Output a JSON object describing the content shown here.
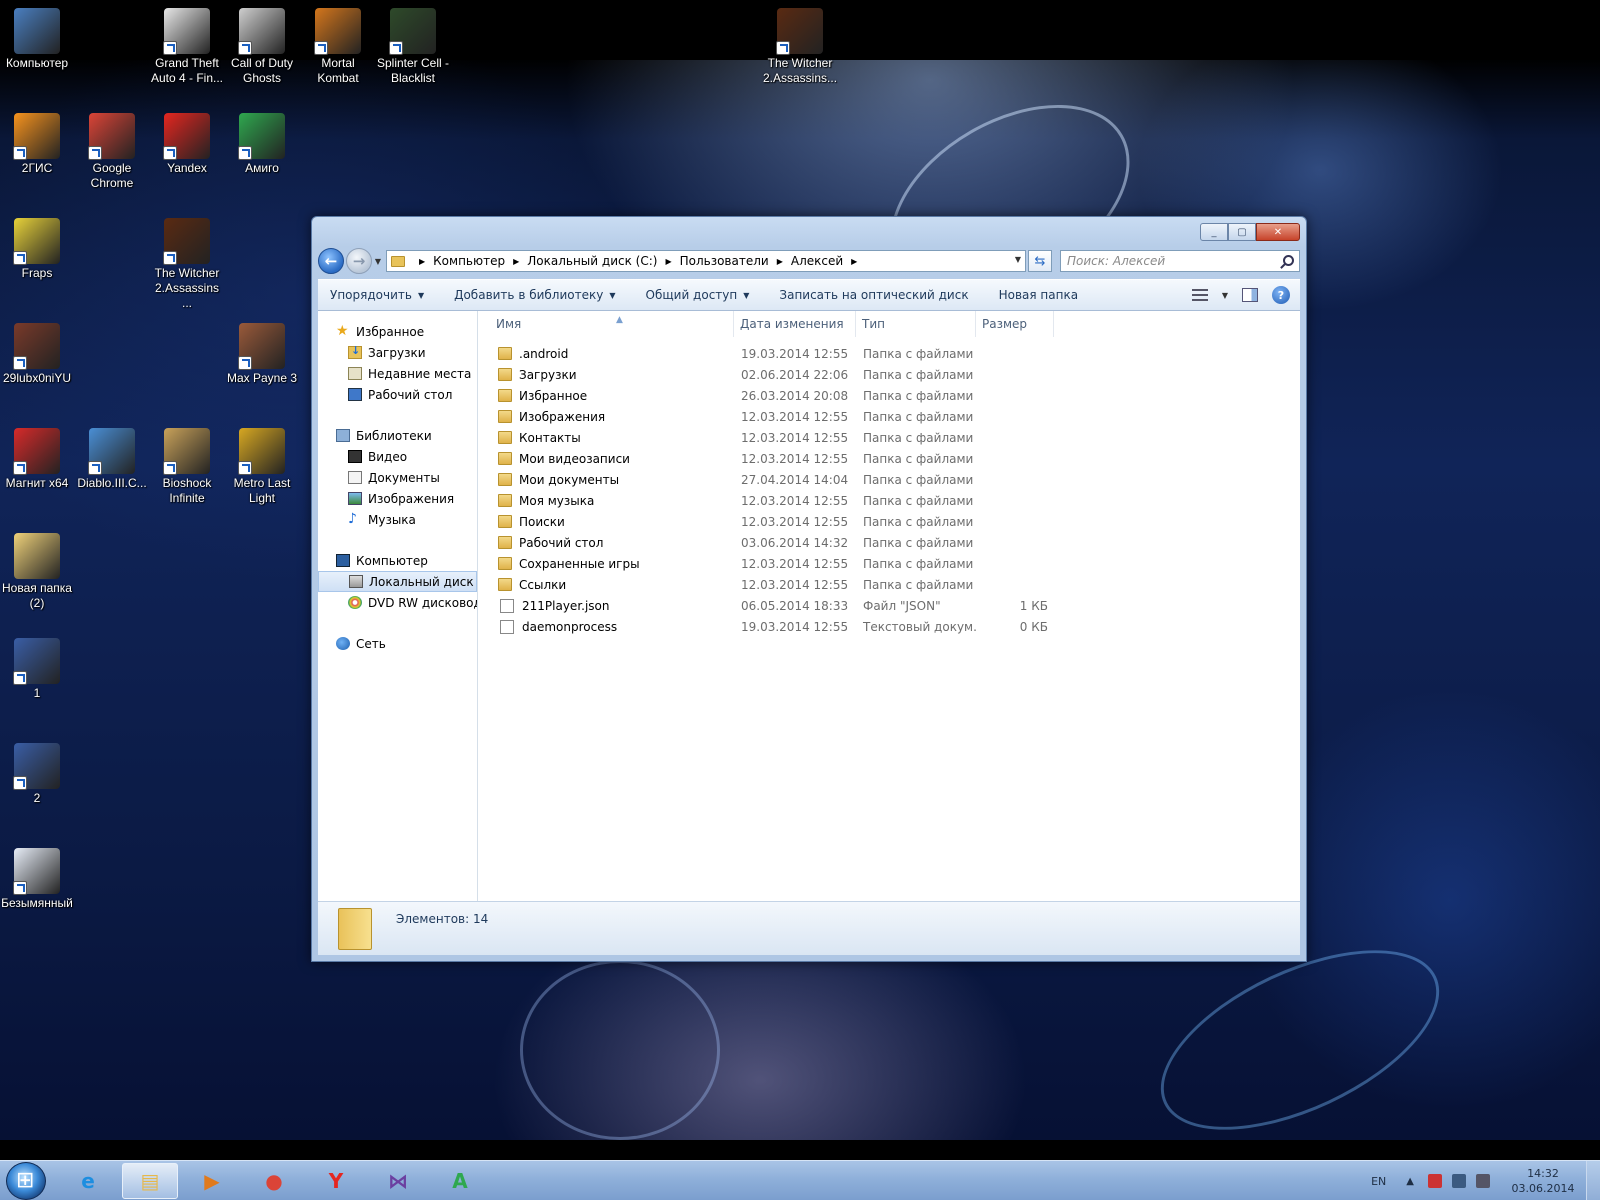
{
  "desktop": {
    "icons": [
      {
        "label": "Компьютер",
        "color": "#4a7fc1"
      },
      {
        "label": "Grand Theft Auto 4 - Fin...",
        "color": "#e8e8e8"
      },
      {
        "label": "Call of Duty Ghosts",
        "color": "#cfcfcf"
      },
      {
        "label": "Mortal Kombat",
        "color": "#d4761c"
      },
      {
        "label": "Splinter Cell - Blacklist",
        "color": "#2e4a2a"
      },
      {
        "label": "The Witcher 2.Assassins...",
        "color": "#5a2a12"
      },
      {
        "label": "2ГИС",
        "color": "#f7931e"
      },
      {
        "label": "Google Chrome",
        "color": "#db4437"
      },
      {
        "label": "Yandex",
        "color": "#e52620"
      },
      {
        "label": "Амиго",
        "color": "#2fa84f"
      },
      {
        "label": "Fraps",
        "color": "#e8d23a"
      },
      {
        "label": "The Witcher 2.Assassins ...",
        "color": "#5a2a12"
      },
      {
        "label": "29lubx0niYU",
        "color": "#7a3a2a"
      },
      {
        "label": "Max Payne 3",
        "color": "#9a5a3a"
      },
      {
        "label": "Магнит x64",
        "color": "#d82a2a"
      },
      {
        "label": "Diablo.III.C...",
        "color": "#4a8fd6"
      },
      {
        "label": "Bioshock Infinite",
        "color": "#c9a25a"
      },
      {
        "label": "Metro Last Light",
        "color": "#d8a822"
      },
      {
        "label": "Новая папка (2)",
        "color": "#f0d27a"
      },
      {
        "label": "1",
        "color": "#3a5ea6"
      },
      {
        "label": "2",
        "color": "#3a5ea6"
      },
      {
        "label": "Безымянный",
        "color": "#e8eef8"
      }
    ]
  },
  "window": {
    "caption_buttons": [
      "_",
      "▢",
      "✕"
    ],
    "address": {
      "crumbs": [
        "Компьютер",
        "Локальный диск (C:)",
        "Пользователи",
        "Алексей"
      ]
    },
    "search": {
      "placeholder": "Поиск: Алексей"
    },
    "toolbar": {
      "organize": "Упорядочить",
      "add_library": "Добавить в библиотеку",
      "share": "Общий доступ",
      "burn": "Записать на оптический диск",
      "new_folder": "Новая папка"
    },
    "nav": {
      "favorites": "Избранное",
      "downloads": "Загрузки",
      "recent": "Недавние места",
      "desktop": "Рабочий стол",
      "libraries": "Библиотеки",
      "video": "Видео",
      "documents": "Документы",
      "pictures": "Изображения",
      "music": "Музыка",
      "computer": "Компьютер",
      "local_disk": "Локальный диск (C",
      "dvd": "DVD RW дисковод (",
      "network": "Сеть"
    },
    "columns": {
      "name": "Имя",
      "date": "Дата изменения",
      "type": "Тип",
      "size": "Размер"
    },
    "files": [
      {
        "name": ".android",
        "date": "19.03.2014 12:55",
        "type": "Папка с файлами",
        "size": "",
        "kind": "folder"
      },
      {
        "name": "Загрузки",
        "date": "02.06.2014 22:06",
        "type": "Папка с файлами",
        "size": "",
        "kind": "folder"
      },
      {
        "name": "Избранное",
        "date": "26.03.2014 20:08",
        "type": "Папка с файлами",
        "size": "",
        "kind": "folder"
      },
      {
        "name": "Изображения",
        "date": "12.03.2014 12:55",
        "type": "Папка с файлами",
        "size": "",
        "kind": "folder"
      },
      {
        "name": "Контакты",
        "date": "12.03.2014 12:55",
        "type": "Папка с файлами",
        "size": "",
        "kind": "folder"
      },
      {
        "name": "Мои видеозаписи",
        "date": "12.03.2014 12:55",
        "type": "Папка с файлами",
        "size": "",
        "kind": "folder"
      },
      {
        "name": "Мои документы",
        "date": "27.04.2014 14:04",
        "type": "Папка с файлами",
        "size": "",
        "kind": "folder"
      },
      {
        "name": "Моя музыка",
        "date": "12.03.2014 12:55",
        "type": "Папка с файлами",
        "size": "",
        "kind": "folder"
      },
      {
        "name": "Поиски",
        "date": "12.03.2014 12:55",
        "type": "Папка с файлами",
        "size": "",
        "kind": "folder"
      },
      {
        "name": "Рабочий стол",
        "date": "03.06.2014 14:32",
        "type": "Папка с файлами",
        "size": "",
        "kind": "folder"
      },
      {
        "name": "Сохраненные игры",
        "date": "12.03.2014 12:55",
        "type": "Папка с файлами",
        "size": "",
        "kind": "folder"
      },
      {
        "name": "Ссылки",
        "date": "12.03.2014 12:55",
        "type": "Папка с файлами",
        "size": "",
        "kind": "folder"
      },
      {
        "name": "211Player.json",
        "date": "06.05.2014 18:33",
        "type": "Файл \"JSON\"",
        "size": "1 КБ",
        "kind": "file"
      },
      {
        "name": "daemonprocess",
        "date": "19.03.2014 12:55",
        "type": "Текстовый докум...",
        "size": "0 КБ",
        "kind": "file"
      }
    ],
    "details": {
      "count": "Элементов: 14"
    }
  },
  "taskbar": {
    "apps": [
      {
        "name": "internet-explorer",
        "glyph": "e",
        "color": "#1d8ee0",
        "active": false
      },
      {
        "name": "explorer",
        "glyph": "▤",
        "color": "#e6b84a",
        "active": true
      },
      {
        "name": "media-player",
        "glyph": "▶",
        "color": "#e07a1d",
        "active": false
      },
      {
        "name": "chrome",
        "glyph": "●",
        "color": "#db4437",
        "active": false
      },
      {
        "name": "yandex",
        "glyph": "Y",
        "color": "#e52620",
        "active": false
      },
      {
        "name": "visual-studio",
        "glyph": "⋈",
        "color": "#6b3fa0",
        "active": false
      },
      {
        "name": "amigo",
        "glyph": "A",
        "color": "#2fa84f",
        "active": false
      }
    ],
    "tray": {
      "lang": "EN",
      "time": "14:32",
      "date": "03.06.2014"
    }
  }
}
